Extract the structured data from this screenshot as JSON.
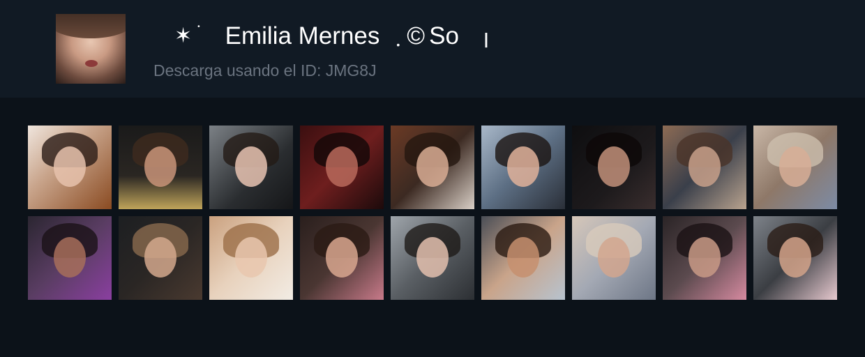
{
  "header": {
    "title_prefix_glyph": "✶",
    "title_name": "Emilia Mernes",
    "title_copyright": "©",
    "title_suffix": "So",
    "subtitle": "Descarga usando el ID: JMG8J"
  },
  "thumbnails": [
    {
      "bg": "linear-gradient(135deg,#f0e6de 0%,#c9a58c 40%,#8a4b22 100%)",
      "face": "#e6c2ad",
      "hair": "#2b1c16"
    },
    {
      "bg": "linear-gradient(180deg,#1a1a1a 0%,#2a2622 60%,#bfa45a 100%)",
      "face": "#c99479",
      "hair": "#3e2a1e"
    },
    {
      "bg": "linear-gradient(135deg,#7c8186 0%,#2a2d30 60%,#151618 100%)",
      "face": "#e7c3b1",
      "hair": "#231a15"
    },
    {
      "bg": "linear-gradient(135deg,#3b0f10 0%,#6e1e1e 50%,#1c0a0b 100%)",
      "face": "#b86a5c",
      "hair": "#120707"
    },
    {
      "bg": "linear-gradient(135deg,#6b3a25 0%,#3c2a22 50%,#d9cfc6 100%)",
      "face": "#d9ad94",
      "hair": "#24160f"
    },
    {
      "bg": "linear-gradient(135deg,#a9b8c9 0%,#5d6f84 50%,#2a2f38 100%)",
      "face": "#e1b29a",
      "hair": "#1b1412"
    },
    {
      "bg": "linear-gradient(135deg,#0e0e10 0%,#1d1a1c 60%,#3a2e2e 100%)",
      "face": "#c2917a",
      "hair": "#0c0808"
    },
    {
      "bg": "linear-gradient(135deg,#8d6b54 0%,#3a3f4a 50%,#b9a38f 100%)",
      "face": "#c8a08a",
      "hair": "#4a3328"
    },
    {
      "bg": "linear-gradient(135deg,#c9b7a7 0%,#8e7868 50%,#7c8ba5 100%)",
      "face": "#d7ae96",
      "hair": "#cdbfae"
    },
    {
      "bg": "linear-gradient(135deg,#2b2631 0%,#5a3d63 50%,#8a3fa0 100%)",
      "face": "#a76f5a",
      "hair": "#1a1216"
    },
    {
      "bg": "linear-gradient(135deg,#1d1f22 0%,#2a2624 50%,#4a3a30 100%)",
      "face": "#d4a88d",
      "hair": "#8a6a4e"
    },
    {
      "bg": "linear-gradient(135deg,#caa17f 0%,#e8d2bd 50%,#f2ece4 100%)",
      "face": "#e9c7ae",
      "hair": "#9b6e47"
    },
    {
      "bg": "linear-gradient(135deg,#2a1f1d 0%,#4a3632 50%,#c87a8a 100%)",
      "face": "#d9a78f",
      "hair": "#2a1a14"
    },
    {
      "bg": "linear-gradient(135deg,#9fa5ab 0%,#5a5f64 50%,#2c2f33 100%)",
      "face": "#e3c0ae",
      "hair": "#1e1a18"
    },
    {
      "bg": "linear-gradient(135deg,#4a4e56 0%,#c9a48a 50%,#b7c3cf 100%)",
      "face": "#c58f6e",
      "hair": "#2a1a12"
    },
    {
      "bg": "linear-gradient(135deg,#d6c7b9 0%,#a4a9b4 50%,#6d7686 100%)",
      "face": "#d2a68e",
      "hair": "#d8cbbb"
    },
    {
      "bg": "linear-gradient(135deg,#2a2426 0%,#5b4a4e 50%,#d68aa0 100%)",
      "face": "#c99a86",
      "hair": "#1a1214"
    },
    {
      "bg": "linear-gradient(135deg,#7e838a 0%,#3b3e43 50%,#e7c9cf 100%)",
      "face": "#d3a38a",
      "hair": "#2b1d17"
    }
  ]
}
